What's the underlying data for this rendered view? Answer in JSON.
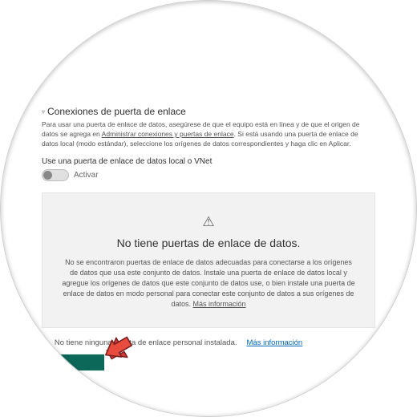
{
  "section": {
    "title": "Conexiones de puerta de enlace",
    "help_a": "Para usar una puerta de enlace de datos, asegúrese de que el equipo está en línea y de que el origen de datos se agrega en ",
    "help_link": "Administrar conexiones y puertas de enlace",
    "help_b": ". Si está usando una puerta de enlace de datos local (modo estándar), seleccione los orígenes de datos correspondientes y haga clic en Aplicar."
  },
  "toggle": {
    "label": "Use una puerta de enlace de datos local o VNet",
    "state": "Activar"
  },
  "empty": {
    "title": "No tiene puertas de enlace de datos.",
    "body_a": "No se encontraron puertas de enlace de datos adecuadas para conectarse a los orígenes de datos que usa este conjunto de datos. Instale una puerta de enlace de datos local y agregue los orígenes de datos que este conjunto de datos use, o bien instale una puerta de enlace de datos en modo personal para conectar este conjunto de datos a sus orígenes de datos. ",
    "more": "Más información"
  },
  "personal": {
    "text": "No tiene ninguna puerta de enlace personal instalada.",
    "more": "Más información"
  }
}
